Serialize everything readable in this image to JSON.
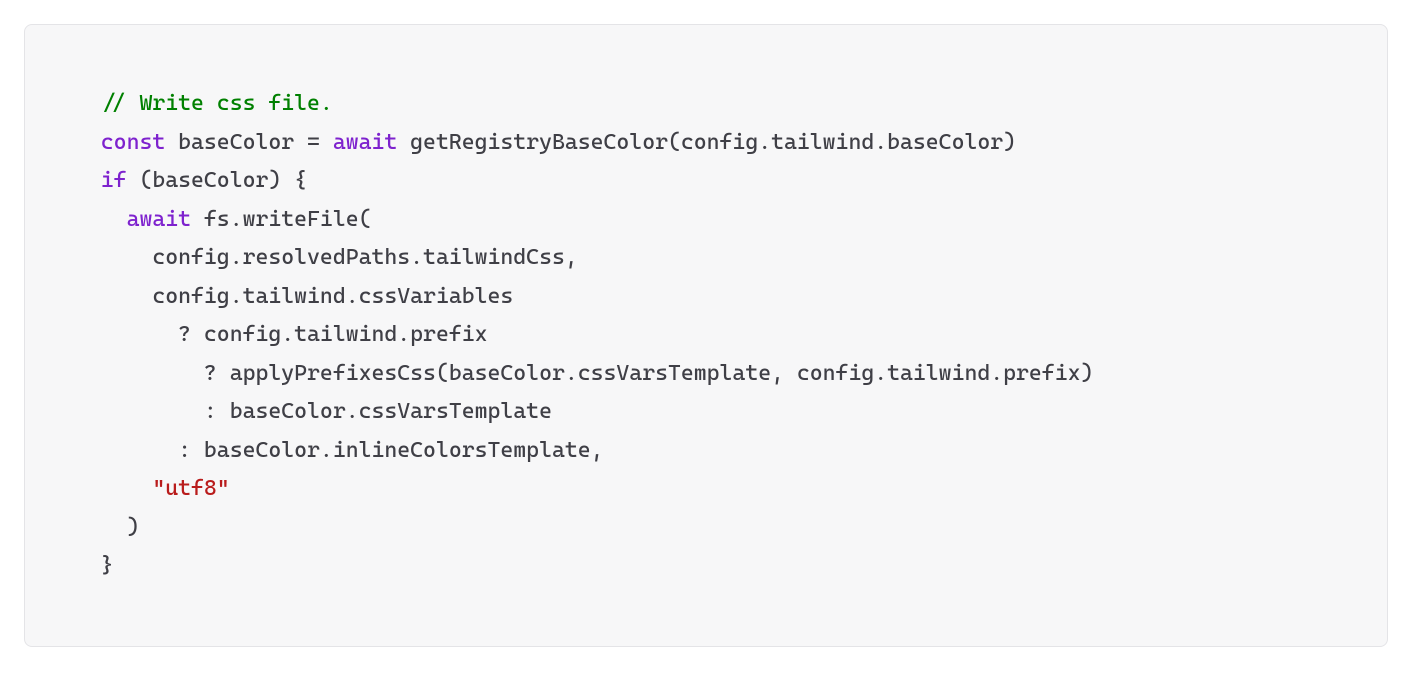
{
  "code": {
    "tokens": [
      [
        {
          "cls": "default",
          "text": "  "
        },
        {
          "cls": "comment",
          "text": "// Write css file."
        }
      ],
      [
        {
          "cls": "default",
          "text": "  "
        },
        {
          "cls": "keyword",
          "text": "const"
        },
        {
          "cls": "default",
          "text": " baseColor = "
        },
        {
          "cls": "keyword",
          "text": "await"
        },
        {
          "cls": "default",
          "text": " getRegistryBaseColor(config.tailwind.baseColor)"
        }
      ],
      [
        {
          "cls": "default",
          "text": "  "
        },
        {
          "cls": "keyword",
          "text": "if"
        },
        {
          "cls": "default",
          "text": " (baseColor) {"
        }
      ],
      [
        {
          "cls": "default",
          "text": "    "
        },
        {
          "cls": "keyword",
          "text": "await"
        },
        {
          "cls": "default",
          "text": " fs.writeFile("
        }
      ],
      [
        {
          "cls": "default",
          "text": "      config.resolvedPaths.tailwindCss,"
        }
      ],
      [
        {
          "cls": "default",
          "text": "      config.tailwind.cssVariables"
        }
      ],
      [
        {
          "cls": "default",
          "text": "        ? config.tailwind.prefix"
        }
      ],
      [
        {
          "cls": "default",
          "text": "          ? applyPrefixesCss(baseColor.cssVarsTemplate, config.tailwind.prefix)"
        }
      ],
      [
        {
          "cls": "default",
          "text": "          : baseColor.cssVarsTemplate"
        }
      ],
      [
        {
          "cls": "default",
          "text": "        : baseColor.inlineColorsTemplate,"
        }
      ],
      [
        {
          "cls": "default",
          "text": "      "
        },
        {
          "cls": "string",
          "text": "\"utf8\""
        }
      ],
      [
        {
          "cls": "default",
          "text": "    )"
        }
      ],
      [
        {
          "cls": "default",
          "text": "  }"
        }
      ]
    ]
  }
}
